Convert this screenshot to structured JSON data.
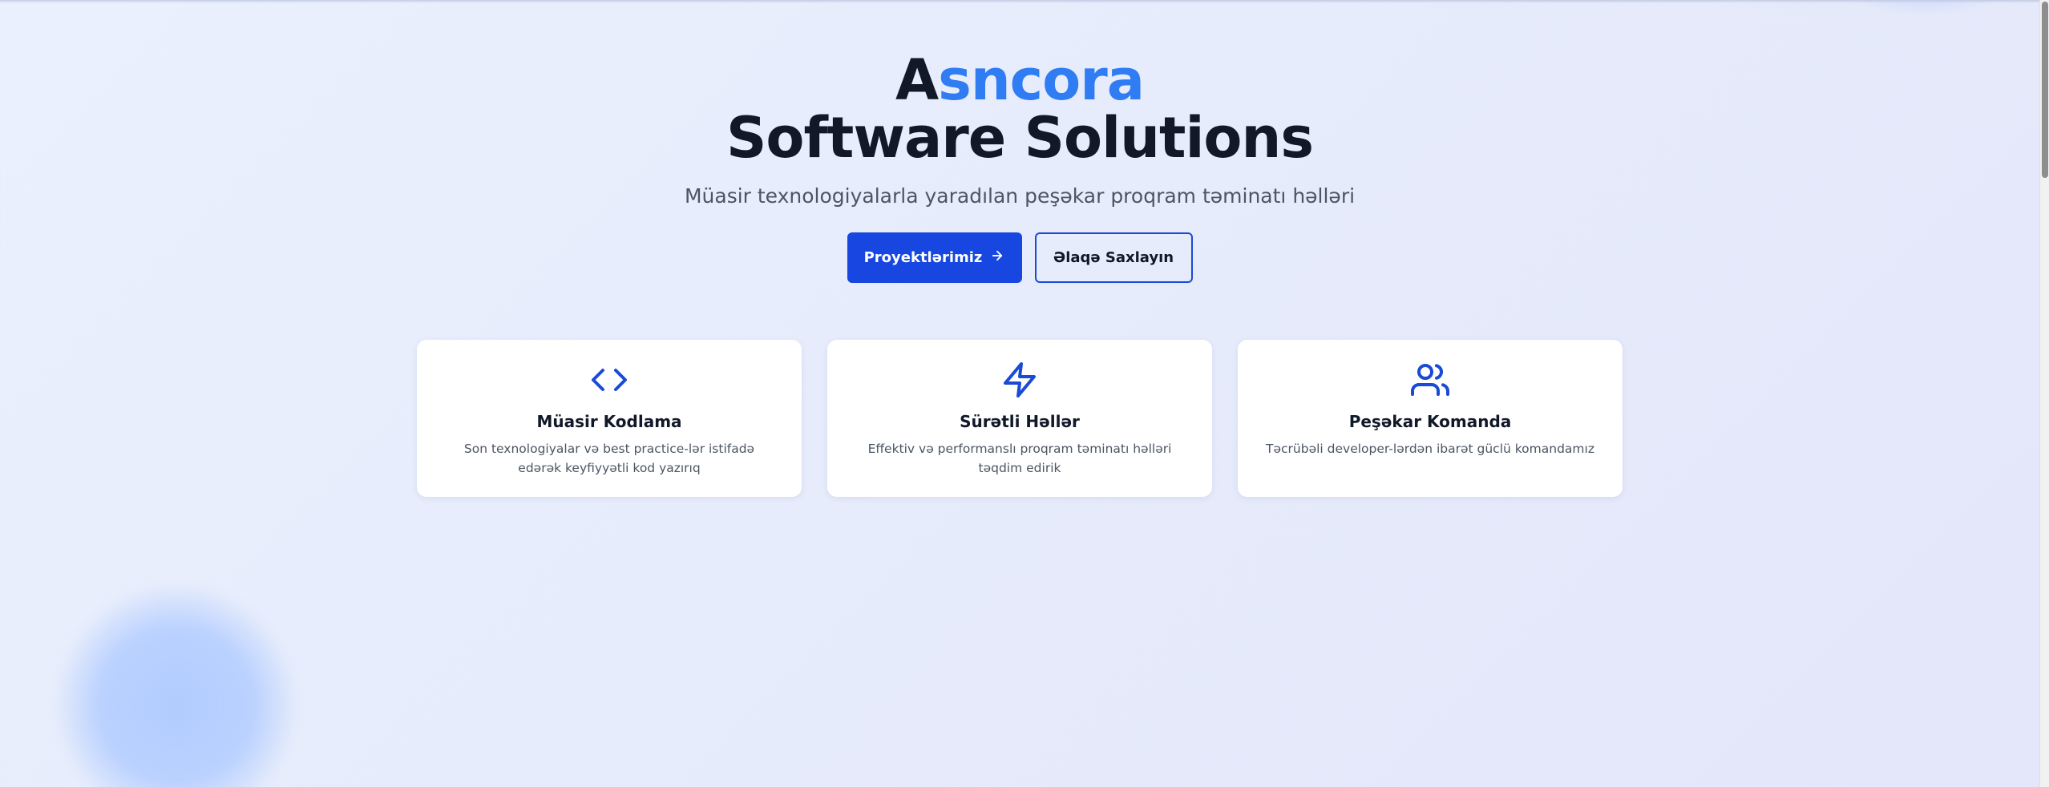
{
  "hero": {
    "title_first_letter": "A",
    "title_rest": "sncora",
    "title_line2": "Software Solutions",
    "subtitle": "Müasir texnologiyalarla yaradılan peşəkar proqram təminatı həlləri"
  },
  "buttons": {
    "primary_label": "Proyektlərimiz",
    "secondary_label": "Əlaqə Saxlayın"
  },
  "features": [
    {
      "icon": "code-icon",
      "title": "Müasir Kodlama",
      "description": "Son texnologiyalar və best practice-lər istifadə edərək keyfiyyətli kod yazırıq"
    },
    {
      "icon": "lightning-icon",
      "title": "Sürətli Həllər",
      "description": "Effektiv və performanslı proqram təminatı həlləri təqdim edirik"
    },
    {
      "icon": "users-icon",
      "title": "Peşəkar Komanda",
      "description": "Təcrübəli developer-lərdən ibarət güclü komandamız"
    }
  ],
  "colors": {
    "accent": "#2f7cf3",
    "primary_button": "#1747e0",
    "icon": "#1a4bd6",
    "heading": "#111827"
  }
}
